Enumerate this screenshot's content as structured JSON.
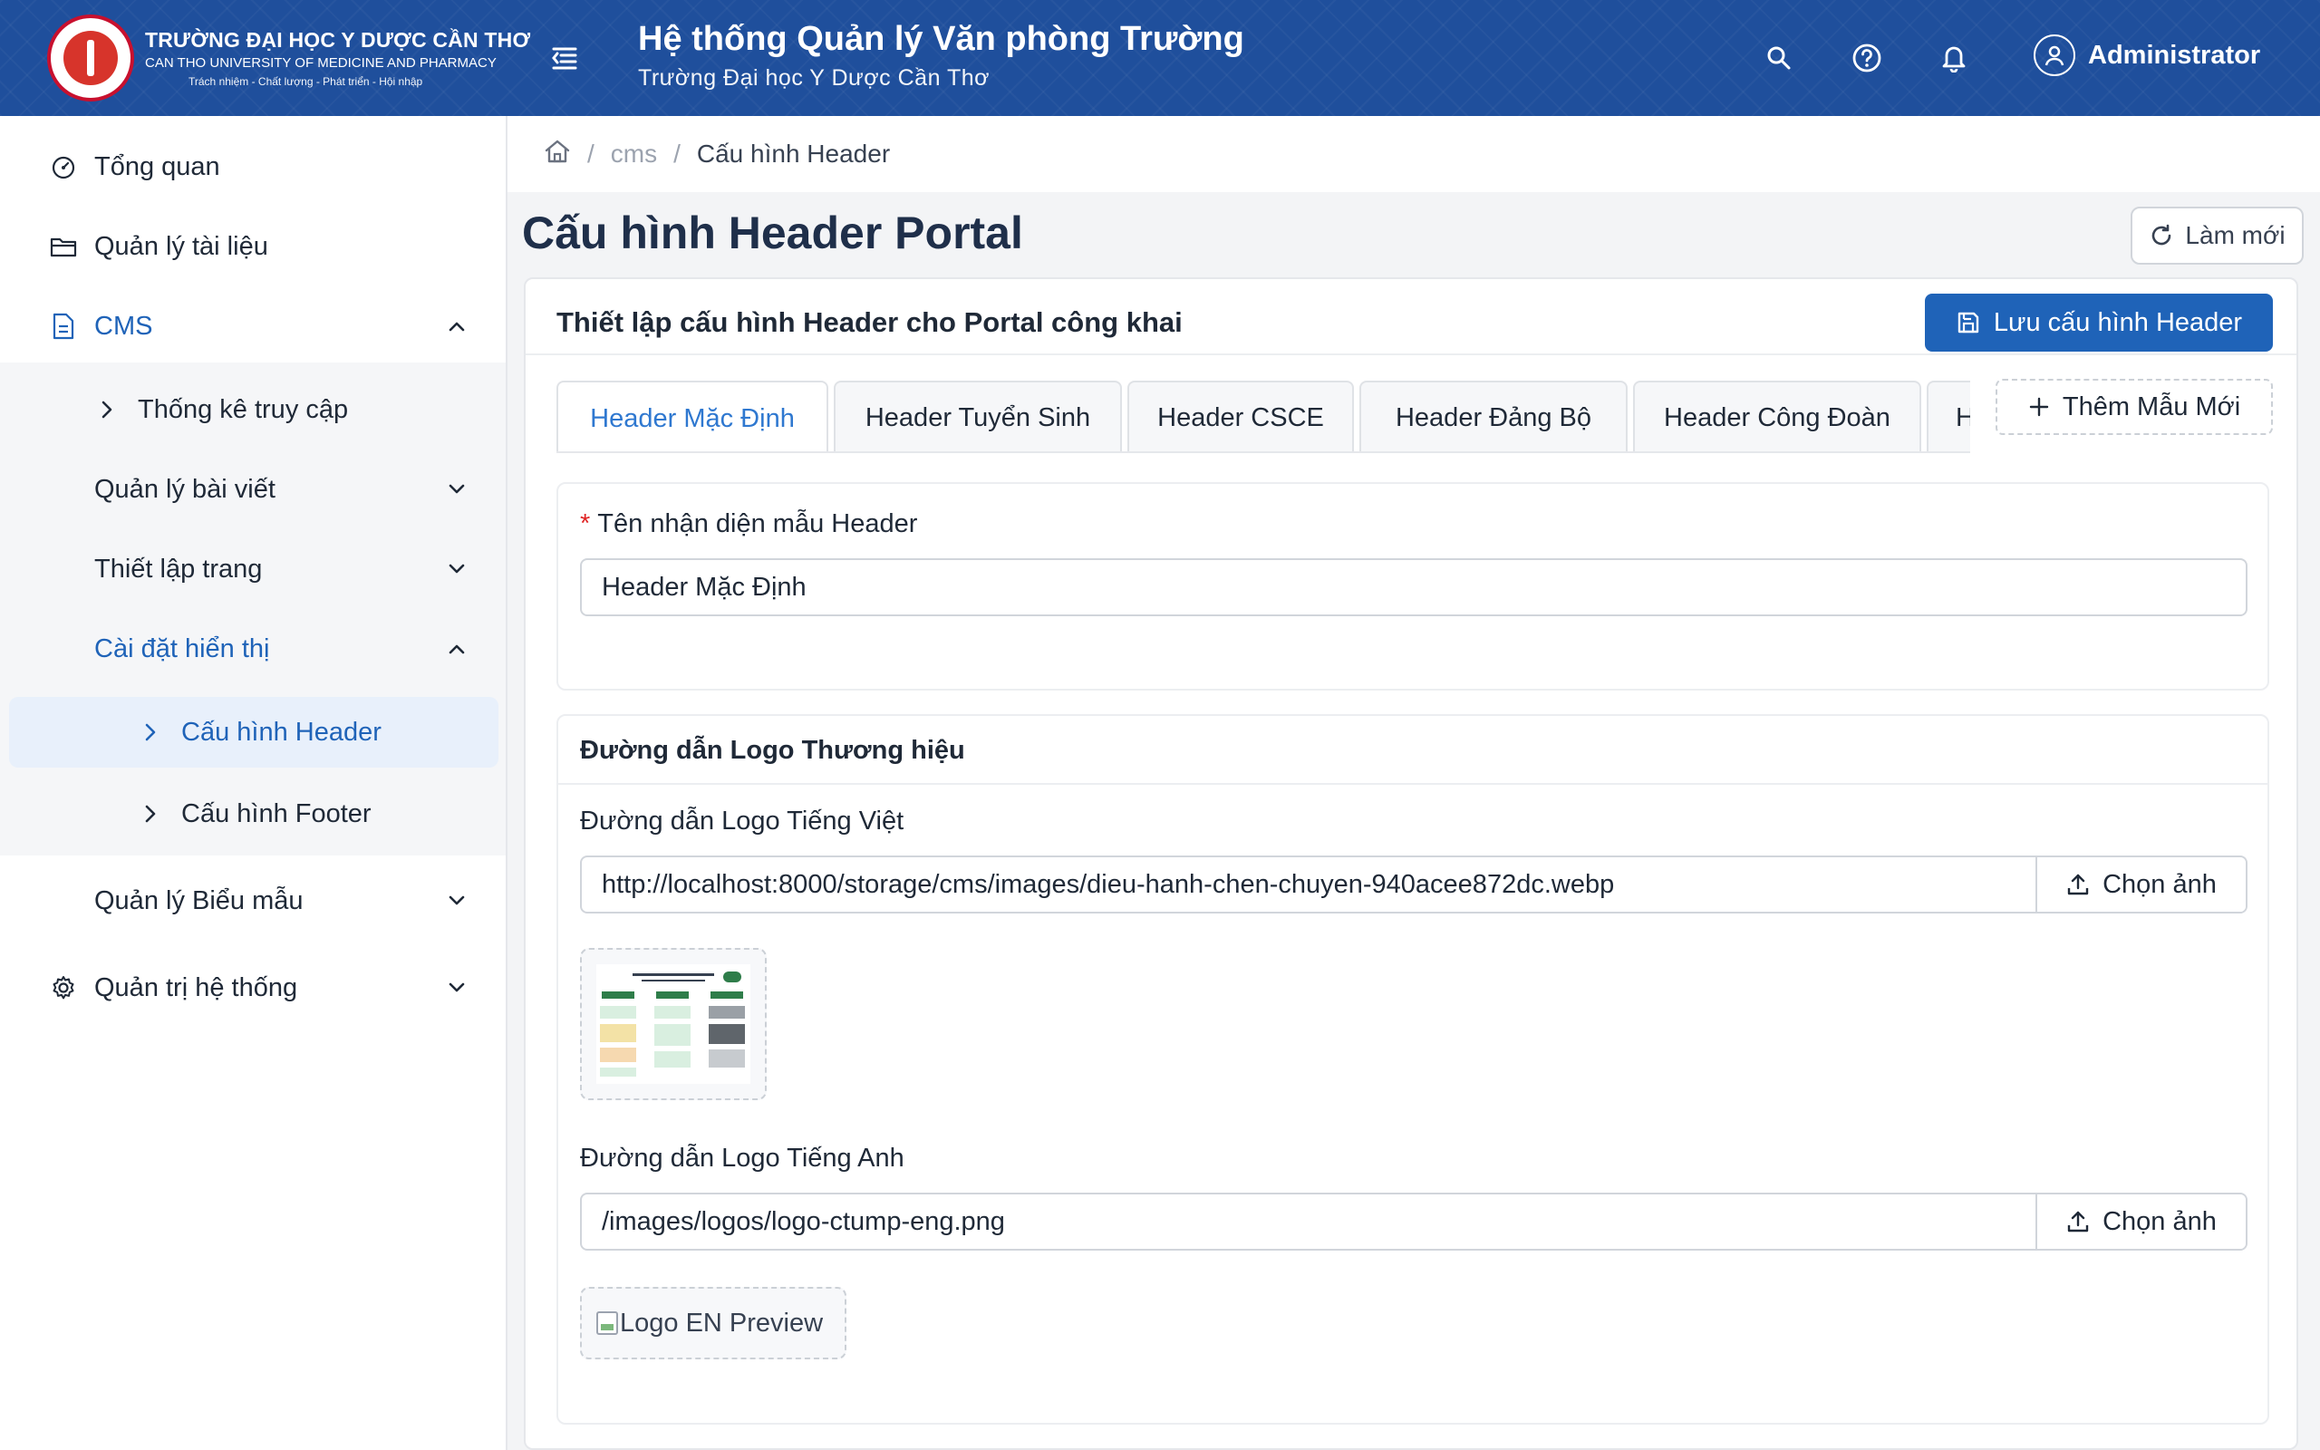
{
  "header": {
    "brand_name": "TRƯỜNG ĐẠI HỌC Y DƯỢC CẦN THƠ",
    "brand_en": "CAN THO UNIVERSITY OF MEDICINE AND PHARMACY",
    "brand_motto": "Trách nhiệm - Chất lượng - Phát triển - Hội nhập",
    "app_title": "Hệ thống Quản lý Văn phòng Trường",
    "app_subtitle": "Trường Đại học Y Dược Cần Thơ",
    "username": "Administrator",
    "icons": [
      "menu-fold-icon",
      "search-icon",
      "help-icon",
      "bell-icon",
      "user-icon"
    ],
    "colors": {
      "primary": "#1f4f9c",
      "accent": "#1f63b8"
    }
  },
  "sidebar": {
    "items": [
      {
        "label": "Tổng quan",
        "icon": "dashboard-icon"
      },
      {
        "label": "Quản lý tài liệu",
        "icon": "folder-icon"
      },
      {
        "label": "CMS",
        "icon": "file-icon",
        "expanded": true
      },
      {
        "label": "Thống kê truy cập"
      },
      {
        "label": "Quản lý bài viết"
      },
      {
        "label": "Thiết lập trang"
      },
      {
        "label": "Cài đặt hiển thị",
        "expanded": true
      },
      {
        "label": "Cấu hình Header",
        "selected": true
      },
      {
        "label": "Cấu hình Footer"
      },
      {
        "label": "Quản lý Biểu mẫu"
      },
      {
        "label": "Quản trị hệ thống",
        "icon": "gear-icon"
      }
    ]
  },
  "breadcrumb": {
    "items": [
      "cms",
      "Cấu hình Header"
    ],
    "separator": "/"
  },
  "page": {
    "title": "Cấu hình Header Portal",
    "refresh_label": "Làm mới"
  },
  "card": {
    "title": "Thiết lập cấu hình Header cho Portal công khai",
    "save_label": "Lưu cấu hình Header",
    "tabs": [
      "Header Mặc Định",
      "Header Tuyển Sinh",
      "Header CSCE",
      "Header Đảng Bộ",
      "Header Công Đoàn",
      "Hea"
    ],
    "active_tab": "Header Mặc Định",
    "add_label": "Thêm Mẫu Mới"
  },
  "form": {
    "name_required": "*",
    "name_label": "Tên nhận diện mẫu Header",
    "name_value": "Header Mặc Định",
    "logo_section_title": "Đường dẫn Logo Thương hiệu",
    "logo_vi_label": "Đường dẫn Logo Tiếng Việt",
    "logo_vi_value": "http://localhost:8000/storage/cms/images/dieu-hanh-chen-chuyen-940acee872dc.webp",
    "logo_en_label": "Đường dẫn Logo Tiếng Anh",
    "logo_en_value": "/images/logos/logo-ctump-eng.png",
    "pick_label": "Chọn ảnh",
    "logo_en_preview_alt": "Logo EN Preview"
  }
}
